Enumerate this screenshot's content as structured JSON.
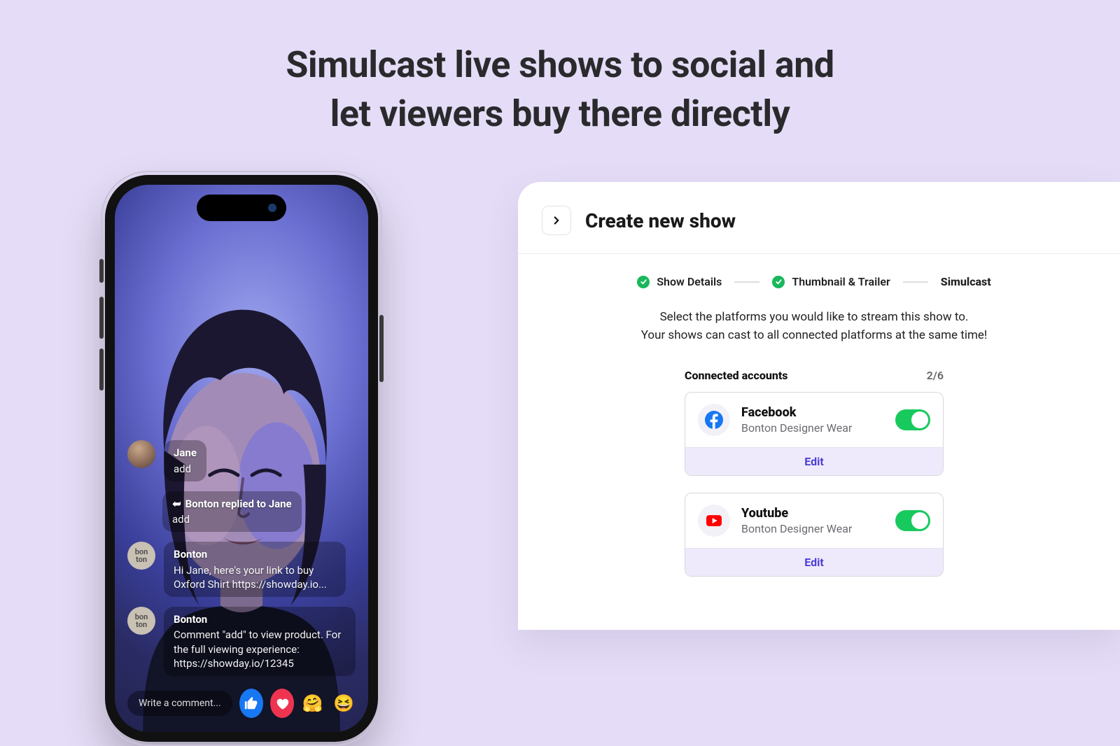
{
  "headline": {
    "line1": "Simulcast live shows to social and",
    "line2": "let viewers buy there directly"
  },
  "phone": {
    "comment_placeholder": "Write a comment...",
    "messages": [
      {
        "avatar": "jane",
        "name": "Jane",
        "body": "add"
      },
      {
        "reply_to": "Bonton replied to Jane",
        "body": "add"
      },
      {
        "avatar": "bonton",
        "name": "Bonton",
        "body": "Hi Jane, here's your link to buy Oxford Shirt https://showday.io..."
      },
      {
        "avatar": "bonton",
        "name": "Bonton",
        "body": "Comment \"add\" to view product. For the full viewing experience: https://showday.io/12345"
      }
    ],
    "reactions": [
      "like",
      "heart",
      "care",
      "laugh"
    ]
  },
  "panel": {
    "title": "Create new show",
    "steps": [
      {
        "label": "Show Details",
        "done": true
      },
      {
        "label": "Thumbnail & Trailer",
        "done": true
      },
      {
        "label": "Simulcast",
        "active": true
      }
    ],
    "helper_line1": "Select the platforms you would like to stream this show to.",
    "helper_line2": "Your shows can cast to all connected platforms at the same time!",
    "accounts_label": "Connected accounts",
    "accounts_count": "2/6",
    "accounts": [
      {
        "platform": "Facebook",
        "handle": "Bonton Designer Wear",
        "edit": "Edit",
        "icon": "fb",
        "on": true
      },
      {
        "platform": "Youtube",
        "handle": "Bonton Designer Wear",
        "edit": "Edit",
        "icon": "yt",
        "on": true
      }
    ]
  }
}
